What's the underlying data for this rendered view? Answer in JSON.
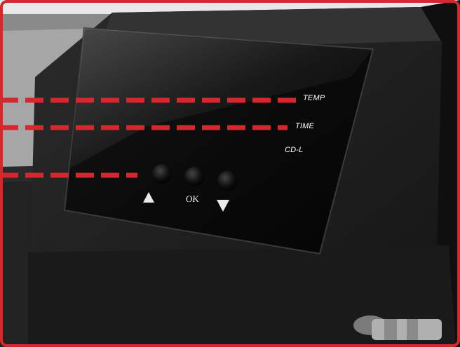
{
  "panel": {
    "labels": {
      "temp": "TEMP",
      "time": "TIME",
      "countdown": "CD-L"
    },
    "buttons": [
      {
        "id": "up",
        "symbol": "▲"
      },
      {
        "id": "ok",
        "symbol": "OK"
      },
      {
        "id": "down",
        "symbol": "▼"
      }
    ]
  },
  "colors": {
    "accent": "#d7262c",
    "housing": "#1c1c1c",
    "panel_glass": "#0c0c0c",
    "label_text": "#ffffff"
  }
}
